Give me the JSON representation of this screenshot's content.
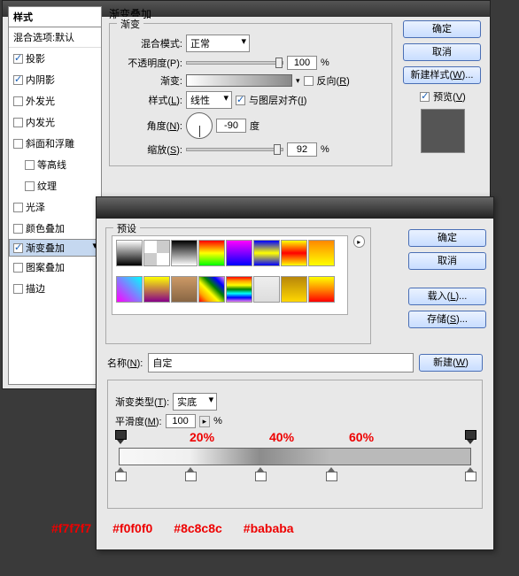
{
  "styles_panel": {
    "header": "样式",
    "subheader": "混合选项:默认",
    "items": [
      {
        "label": "投影",
        "checked": true
      },
      {
        "label": "内阴影",
        "checked": true
      },
      {
        "label": "外发光",
        "checked": false
      },
      {
        "label": "内发光",
        "checked": false
      },
      {
        "label": "斜面和浮雕",
        "checked": false
      },
      {
        "label": "等高线",
        "checked": false,
        "indent": true
      },
      {
        "label": "纹理",
        "checked": false,
        "indent": true
      },
      {
        "label": "光泽",
        "checked": false
      },
      {
        "label": "颜色叠加",
        "checked": false
      },
      {
        "label": "渐变叠加",
        "checked": true,
        "selected": true
      },
      {
        "label": "图案叠加",
        "checked": false
      },
      {
        "label": "描边",
        "checked": false
      }
    ]
  },
  "grad_overlay": {
    "title": "渐变叠加",
    "legend": "渐变",
    "blend_lbl": "混合模式:",
    "blend_val": "正常",
    "opacity_lbl": "不透明度(P):",
    "opacity_val": "100",
    "opacity_unit": "%",
    "grad_lbl": "渐变:",
    "reverse_lbl": "反向(R)",
    "style_lbl": "样式(L):",
    "style_val": "线性",
    "align_lbl": "与图层对齐(I)",
    "angle_lbl": "角度(N):",
    "angle_val": "-90",
    "angle_unit": "度",
    "scale_lbl": "缩放(S):",
    "scale_val": "92",
    "scale_unit": "%"
  },
  "buttons": {
    "ok": "确定",
    "cancel": "取消",
    "new_style": "新建样式(W)...",
    "preview": "预览(V)"
  },
  "grad_editor": {
    "preset_legend": "预设",
    "ok": "确定",
    "cancel": "取消",
    "load": "载入(L)...",
    "save": "存储(S)...",
    "new": "新建(W)",
    "name_lbl": "名称(N):",
    "name_val": "自定",
    "type_lbl": "渐变类型(T):",
    "type_val": "实底",
    "smooth_lbl": "平滑度(M):",
    "smooth_val": "100",
    "smooth_unit": "%",
    "pct_labels": [
      "20%",
      "40%",
      "60%"
    ],
    "hex_labels": [
      "#f7f7f7",
      "#f0f0f0",
      "#8c8c8c",
      "#bababa"
    ]
  },
  "swatches": [
    "linear-gradient(#fff,#000)",
    "repeating-conic-gradient(#ccc 0 25%,#fff 0 50%)",
    "linear-gradient(#000,#fff)",
    "linear-gradient(#f00,#ff0,#0f0)",
    "linear-gradient(#f0f,#00f)",
    "linear-gradient(#00f,#ff0,#00f)",
    "linear-gradient(#ff0,#f00,#ff0)",
    "linear-gradient(#f80,#ff0)",
    "linear-gradient(45deg,#f0f,#0ff)",
    "linear-gradient(#ff0,#808)",
    "linear-gradient(#c96,#864)",
    "linear-gradient(45deg,red,orange,yellow,green,blue,violet)",
    "linear-gradient(red,orange,yellow,green,cyan,blue,violet)",
    "linear-gradient(#eee,#ddd)",
    "linear-gradient(#b8860b,#ffd700)",
    "linear-gradient(#ff0,#f80,#f00)"
  ]
}
